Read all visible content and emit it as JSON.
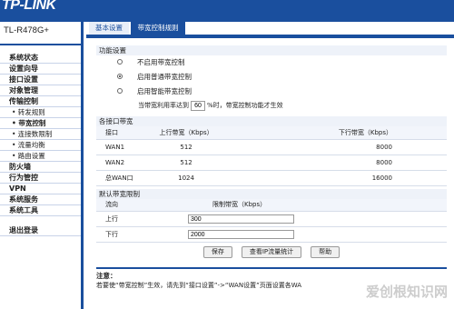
{
  "header": {
    "logo": "TP-LINK"
  },
  "sidebar": {
    "model": "TL-R478G+",
    "items": [
      {
        "label": "系统状态",
        "kind": "group"
      },
      {
        "label": "设置向导",
        "kind": "group"
      },
      {
        "label": "接口设置",
        "kind": "group"
      },
      {
        "label": "对象管理",
        "kind": "group"
      },
      {
        "label": "传输控制",
        "kind": "group-bold"
      },
      {
        "label": "• 转发规则",
        "kind": "sub"
      },
      {
        "label": "• 带宽控制",
        "kind": "sub-active"
      },
      {
        "label": "• 连接数限制",
        "kind": "sub"
      },
      {
        "label": "• 流量均衡",
        "kind": "sub"
      },
      {
        "label": "• 路由设置",
        "kind": "sub"
      },
      {
        "label": "防火墙",
        "kind": "group"
      },
      {
        "label": "行为管控",
        "kind": "group"
      },
      {
        "label": "VPN",
        "kind": "group"
      },
      {
        "label": "系统服务",
        "kind": "group"
      },
      {
        "label": "系统工具",
        "kind": "group"
      },
      {
        "label": "退出登录",
        "kind": "group-gap"
      }
    ]
  },
  "tabs": [
    {
      "label": "基本设置"
    },
    {
      "label": "带宽控制规则"
    }
  ],
  "func": {
    "title": "功能设置",
    "options": [
      {
        "label": "不启用带宽控制",
        "checked": false
      },
      {
        "label": "启用普通带宽控制",
        "checked": true
      },
      {
        "label": "启用智能带宽控制",
        "checked": false
      }
    ],
    "threshold_prefix": "当带宽利用率达到",
    "threshold_value": "60",
    "threshold_suffix": "%时，带宽控制功能才生效"
  },
  "iface": {
    "title": "各接口带宽",
    "headers": [
      "接口",
      "上行带宽（Kbps）",
      "下行带宽（Kbps）"
    ],
    "rows": [
      [
        "WAN1",
        "512",
        "8000"
      ],
      [
        "WAN2",
        "512",
        "8000"
      ],
      [
        "总WAN口",
        "1024",
        "16000"
      ]
    ]
  },
  "limits": {
    "title": "默认带宽限制",
    "headers": [
      "流向",
      "限制带宽（Kbps）"
    ],
    "rows": [
      {
        "dir": "上行",
        "value": "300"
      },
      {
        "dir": "下行",
        "value": "2000"
      }
    ]
  },
  "buttons": {
    "save": "保存",
    "stats": "查看IP流量统计",
    "help": "帮助"
  },
  "note": {
    "title": "注意：",
    "text": "若要使“带宽控制”生效，请先到“接口设置”->“WAN设置”页面设置各WA"
  },
  "watermark": "爱创根知识网",
  "colors": {
    "brand": "#1a4f9e"
  }
}
